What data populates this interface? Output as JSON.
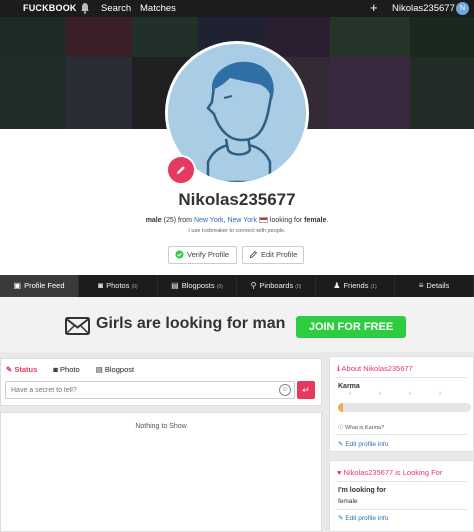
{
  "topnav": {
    "logo": "FUCKBOOK",
    "search_label": "Search",
    "matches_label": "Matches",
    "plus_label": "+",
    "username": "Nikolas235677",
    "avatar_initials": "N"
  },
  "profile": {
    "username": "Nikolas235677",
    "gender": "male",
    "age": "(25)",
    "from_text": "from",
    "city": "New York",
    "state": "New York",
    "looking_text": "looking for",
    "looking_for": "female",
    "sub_text": "I use Icebreaker to connect with people.",
    "verify_label": "Verify Profile",
    "edit_label": "Edit Profile"
  },
  "tabs": [
    {
      "label": "Profile Feed",
      "count": "",
      "icon": "feed-icon"
    },
    {
      "label": "Photos",
      "count": "(0)",
      "icon": "camera-icon"
    },
    {
      "label": "Blogposts",
      "count": "(0)",
      "icon": "book-icon"
    },
    {
      "label": "Pinboards",
      "count": "(0)",
      "icon": "pin-icon"
    },
    {
      "label": "Friends",
      "count": "(1)",
      "icon": "users-icon"
    },
    {
      "label": "Details",
      "count": "",
      "icon": "bars-icon"
    }
  ],
  "banner": {
    "text": "Girls are looking for man",
    "join_label": "JOIN FOR FREE",
    "join_color": "#2ecc40"
  },
  "status": {
    "tab_status": "Status",
    "tab_photo": "Photo",
    "tab_blogpost": "Blogpost",
    "placeholder": "Have a secret to tell?"
  },
  "feed": {
    "empty_text": "Nothing to Show"
  },
  "about": {
    "title": "About Nikolas235677",
    "karma_label": "Karma",
    "karma_level": 0.04,
    "what_is_karma": "What is Karma?",
    "edit_link": "Edit profile info"
  },
  "looking": {
    "title": "Nikolas235677 is Looking For",
    "label": "I'm looking for",
    "value": "female",
    "edit_link": "Edit profile info"
  },
  "colors": {
    "accent": "#e63960",
    "link": "#2a6db5",
    "nav_bg": "#1c1c1c"
  }
}
